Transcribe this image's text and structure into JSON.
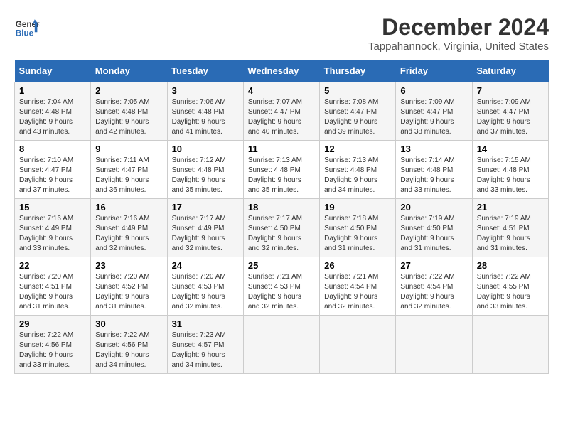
{
  "logo": {
    "general": "General",
    "blue": "Blue"
  },
  "title": "December 2024",
  "subtitle": "Tappahannock, Virginia, United States",
  "weekdays": [
    "Sunday",
    "Monday",
    "Tuesday",
    "Wednesday",
    "Thursday",
    "Friday",
    "Saturday"
  ],
  "weeks": [
    [
      {
        "day": "1",
        "sunrise": "7:04 AM",
        "sunset": "4:48 PM",
        "daylight": "9 hours and 43 minutes."
      },
      {
        "day": "2",
        "sunrise": "7:05 AM",
        "sunset": "4:48 PM",
        "daylight": "9 hours and 42 minutes."
      },
      {
        "day": "3",
        "sunrise": "7:06 AM",
        "sunset": "4:48 PM",
        "daylight": "9 hours and 41 minutes."
      },
      {
        "day": "4",
        "sunrise": "7:07 AM",
        "sunset": "4:47 PM",
        "daylight": "9 hours and 40 minutes."
      },
      {
        "day": "5",
        "sunrise": "7:08 AM",
        "sunset": "4:47 PM",
        "daylight": "9 hours and 39 minutes."
      },
      {
        "day": "6",
        "sunrise": "7:09 AM",
        "sunset": "4:47 PM",
        "daylight": "9 hours and 38 minutes."
      },
      {
        "day": "7",
        "sunrise": "7:09 AM",
        "sunset": "4:47 PM",
        "daylight": "9 hours and 37 minutes."
      }
    ],
    [
      {
        "day": "8",
        "sunrise": "7:10 AM",
        "sunset": "4:47 PM",
        "daylight": "9 hours and 37 minutes."
      },
      {
        "day": "9",
        "sunrise": "7:11 AM",
        "sunset": "4:47 PM",
        "daylight": "9 hours and 36 minutes."
      },
      {
        "day": "10",
        "sunrise": "7:12 AM",
        "sunset": "4:48 PM",
        "daylight": "9 hours and 35 minutes."
      },
      {
        "day": "11",
        "sunrise": "7:13 AM",
        "sunset": "4:48 PM",
        "daylight": "9 hours and 35 minutes."
      },
      {
        "day": "12",
        "sunrise": "7:13 AM",
        "sunset": "4:48 PM",
        "daylight": "9 hours and 34 minutes."
      },
      {
        "day": "13",
        "sunrise": "7:14 AM",
        "sunset": "4:48 PM",
        "daylight": "9 hours and 33 minutes."
      },
      {
        "day": "14",
        "sunrise": "7:15 AM",
        "sunset": "4:48 PM",
        "daylight": "9 hours and 33 minutes."
      }
    ],
    [
      {
        "day": "15",
        "sunrise": "7:16 AM",
        "sunset": "4:49 PM",
        "daylight": "9 hours and 33 minutes."
      },
      {
        "day": "16",
        "sunrise": "7:16 AM",
        "sunset": "4:49 PM",
        "daylight": "9 hours and 32 minutes."
      },
      {
        "day": "17",
        "sunrise": "7:17 AM",
        "sunset": "4:49 PM",
        "daylight": "9 hours and 32 minutes."
      },
      {
        "day": "18",
        "sunrise": "7:17 AM",
        "sunset": "4:50 PM",
        "daylight": "9 hours and 32 minutes."
      },
      {
        "day": "19",
        "sunrise": "7:18 AM",
        "sunset": "4:50 PM",
        "daylight": "9 hours and 31 minutes."
      },
      {
        "day": "20",
        "sunrise": "7:19 AM",
        "sunset": "4:50 PM",
        "daylight": "9 hours and 31 minutes."
      },
      {
        "day": "21",
        "sunrise": "7:19 AM",
        "sunset": "4:51 PM",
        "daylight": "9 hours and 31 minutes."
      }
    ],
    [
      {
        "day": "22",
        "sunrise": "7:20 AM",
        "sunset": "4:51 PM",
        "daylight": "9 hours and 31 minutes."
      },
      {
        "day": "23",
        "sunrise": "7:20 AM",
        "sunset": "4:52 PM",
        "daylight": "9 hours and 31 minutes."
      },
      {
        "day": "24",
        "sunrise": "7:20 AM",
        "sunset": "4:53 PM",
        "daylight": "9 hours and 32 minutes."
      },
      {
        "day": "25",
        "sunrise": "7:21 AM",
        "sunset": "4:53 PM",
        "daylight": "9 hours and 32 minutes."
      },
      {
        "day": "26",
        "sunrise": "7:21 AM",
        "sunset": "4:54 PM",
        "daylight": "9 hours and 32 minutes."
      },
      {
        "day": "27",
        "sunrise": "7:22 AM",
        "sunset": "4:54 PM",
        "daylight": "9 hours and 32 minutes."
      },
      {
        "day": "28",
        "sunrise": "7:22 AM",
        "sunset": "4:55 PM",
        "daylight": "9 hours and 33 minutes."
      }
    ],
    [
      {
        "day": "29",
        "sunrise": "7:22 AM",
        "sunset": "4:56 PM",
        "daylight": "9 hours and 33 minutes."
      },
      {
        "day": "30",
        "sunrise": "7:22 AM",
        "sunset": "4:56 PM",
        "daylight": "9 hours and 34 minutes."
      },
      {
        "day": "31",
        "sunrise": "7:23 AM",
        "sunset": "4:57 PM",
        "daylight": "9 hours and 34 minutes."
      },
      null,
      null,
      null,
      null
    ]
  ]
}
